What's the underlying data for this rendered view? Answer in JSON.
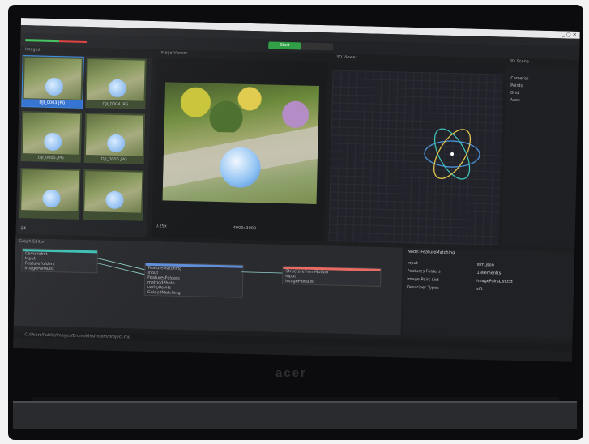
{
  "colors": {
    "accent": "#2f6fd1",
    "status_ok": "#3cbf57",
    "status_err": "#e03a3a",
    "node_red": "#ea6b64",
    "node_teal": "#3ebfb5"
  },
  "toolbar": {
    "toggle_label": "Start"
  },
  "panels": {
    "images_title": "Images",
    "viewer_title": "Image Viewer",
    "view3d_title": "3D Viewer",
    "scene_title": "3D Scene",
    "graph_title": "Graph Editor",
    "attrs_title": "Node: FeatureMatching"
  },
  "images": {
    "thumbnails": [
      {
        "caption": "DJI_0003.JPG",
        "selected": true
      },
      {
        "caption": "DJI_0004.JPG",
        "selected": false
      },
      {
        "caption": "DJI_0005.JPG",
        "selected": false
      },
      {
        "caption": "DJI_0006.JPG",
        "selected": false
      },
      {
        "caption": "",
        "selected": false
      },
      {
        "caption": "",
        "selected": false
      }
    ],
    "count": "24"
  },
  "viewer": {
    "zoom": "0.29x",
    "resolution": "4000x3000"
  },
  "scene": {
    "items": [
      "Cameras",
      "Points",
      "Grid",
      "Axes"
    ]
  },
  "graph_nodes": [
    {
      "title": "CameraInit",
      "color": "teal",
      "rows": [
        "Input",
        "FeatureFolders",
        "ImagePairsList"
      ]
    },
    {
      "title": "FeatureMatching",
      "color": "blue",
      "rows": [
        "Input",
        "FeaturesFolders",
        "methodPhoto",
        "verifyPoints",
        "GuidedMatching"
      ]
    },
    {
      "title": "StructureFromMotion",
      "color": "red",
      "rows": [
        "Input",
        "ImagePairsList"
      ]
    }
  ],
  "attributes": [
    {
      "label": "Input",
      "value": "sfm.json"
    },
    {
      "label": "Features Folders",
      "value": "1 element(s)"
    },
    {
      "label": "Image Pairs List",
      "value": "imagePairsList.txt"
    },
    {
      "label": "Describer Types",
      "value": "sift"
    }
  ],
  "statusline": {
    "path": "C:/Users/Public/Images/Drone/Meshroom/project.mg"
  }
}
